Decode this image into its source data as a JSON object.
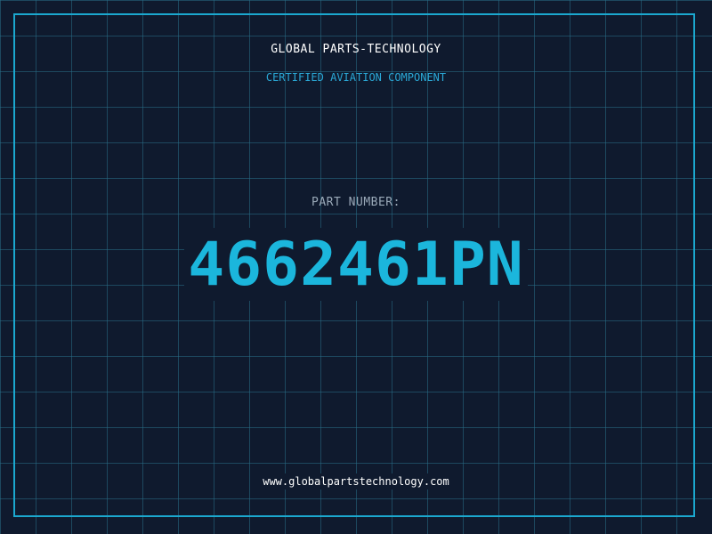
{
  "header": {
    "company_name": "GLOBAL PARTS-TECHNOLOGY",
    "tagline": "CERTIFIED AVIATION COMPONENT"
  },
  "part": {
    "label": "PART NUMBER:",
    "number": "4662461PN"
  },
  "footer": {
    "website": "www.globalpartstechnology.com"
  },
  "colors": {
    "background": "#0f1a2e",
    "grid": "#286e87",
    "accent": "#1bb6dc",
    "frame": "#1ba8cf",
    "label_gray": "#9aa9b8",
    "text_white": "#ffffff"
  }
}
